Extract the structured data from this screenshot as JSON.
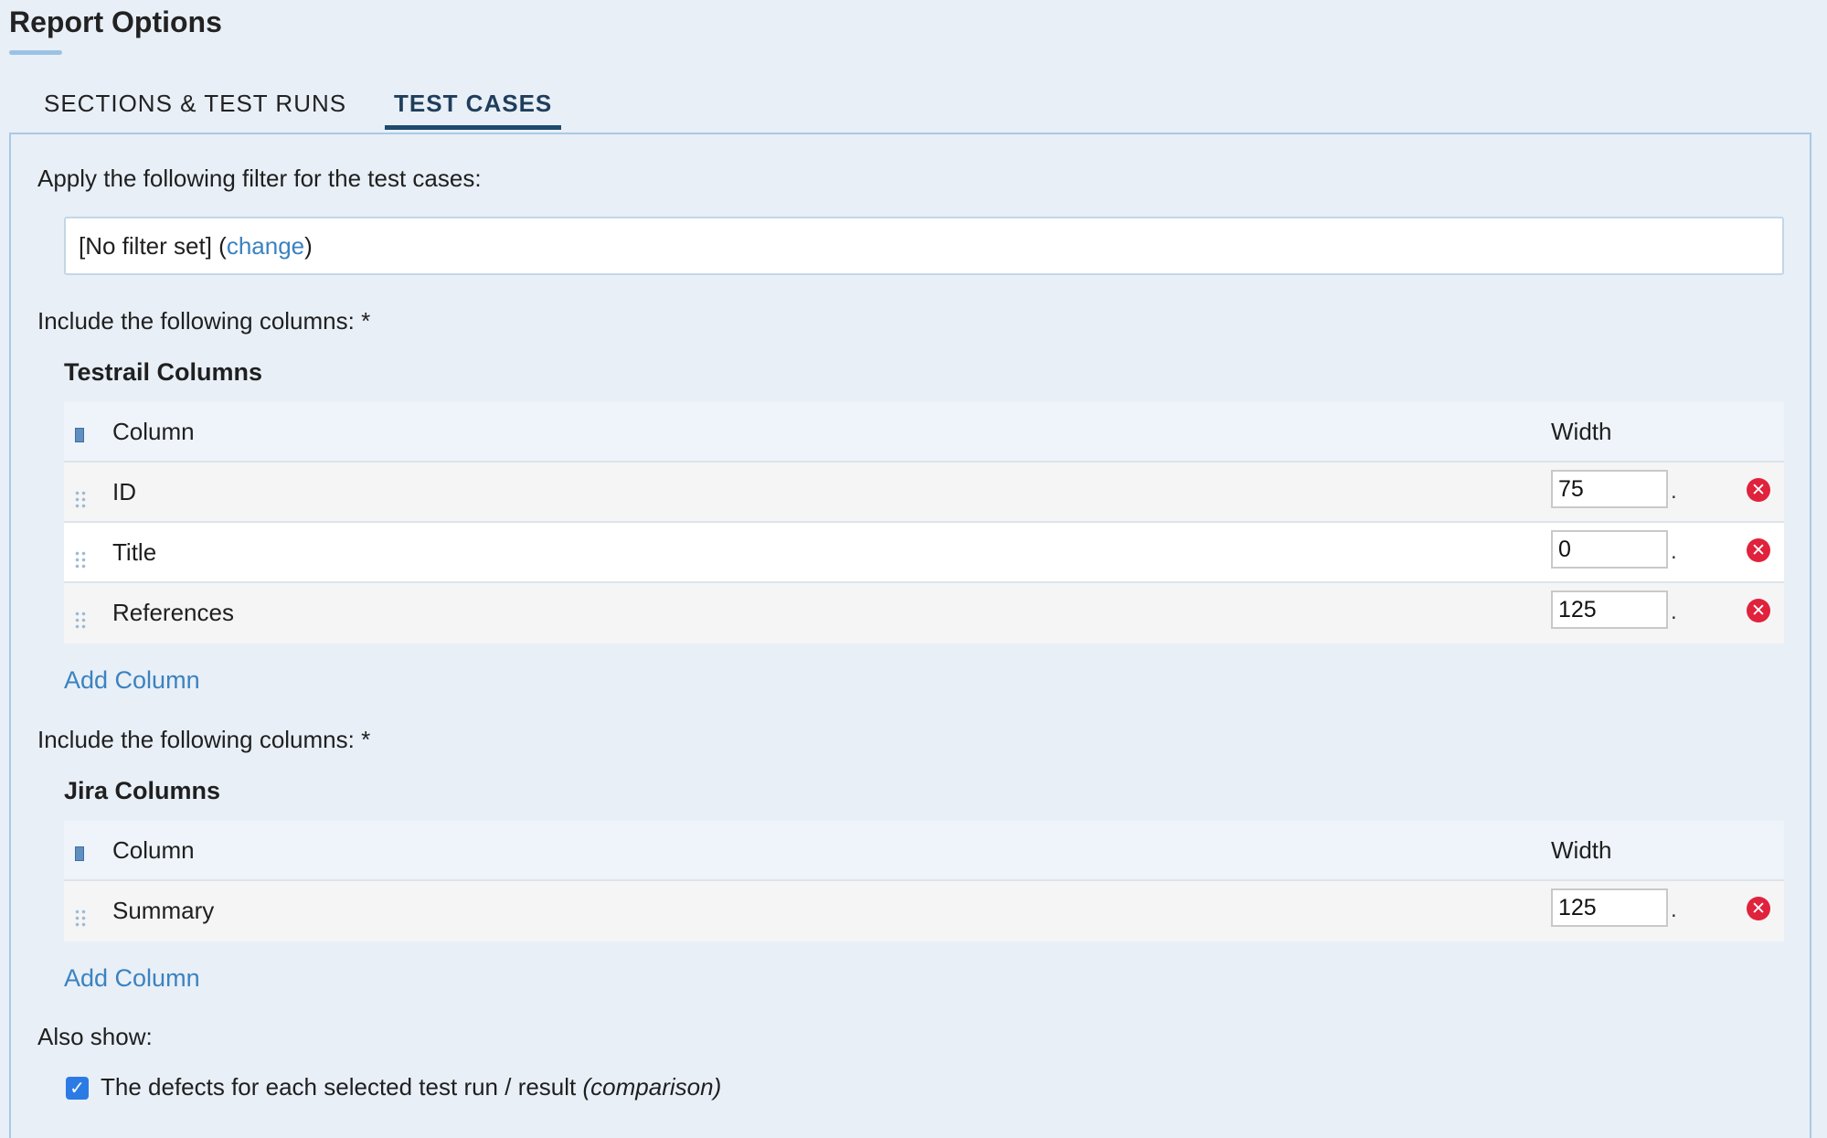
{
  "page_title": "Report Options",
  "tabs": [
    {
      "label": "SECTIONS & TEST RUNS",
      "active": false
    },
    {
      "label": "TEST CASES",
      "active": true
    }
  ],
  "filter": {
    "label": "Apply the following filter for the test cases:",
    "value": "[No filter set]",
    "open_paren": "(",
    "change_link": "change",
    "close_paren": ")"
  },
  "testrail_section": {
    "include_label": "Include the following columns: *",
    "group_title": "Testrail Columns",
    "header": {
      "column": "Column",
      "width": "Width"
    },
    "rows": [
      {
        "name": "ID",
        "width": "75",
        "suffix": "."
      },
      {
        "name": "Title",
        "width": "0",
        "suffix": "."
      },
      {
        "name": "References",
        "width": "125",
        "suffix": "."
      }
    ],
    "add_link": "Add Column"
  },
  "jira_section": {
    "include_label": "Include the following columns: *",
    "group_title": "Jira Columns",
    "header": {
      "column": "Column",
      "width": "Width"
    },
    "rows": [
      {
        "name": "Summary",
        "width": "125",
        "suffix": "."
      }
    ],
    "add_link": "Add Column"
  },
  "also_show": {
    "label": "Also show:",
    "checkbox_checked": true,
    "checkbox_text": "The defects for each selected test run / result",
    "checkbox_text_italic": "(comparison)"
  },
  "colors": {
    "background": "#e8eff7",
    "link": "#3b82c0",
    "active_tab_underline": "#1e4a6e",
    "remove_icon": "#e0223c",
    "checkbox": "#2c7be5"
  },
  "icons": {
    "column_header": "column-icon",
    "drag": "drag-handle-icon",
    "remove": "remove-icon",
    "check": "checkmark-icon"
  }
}
